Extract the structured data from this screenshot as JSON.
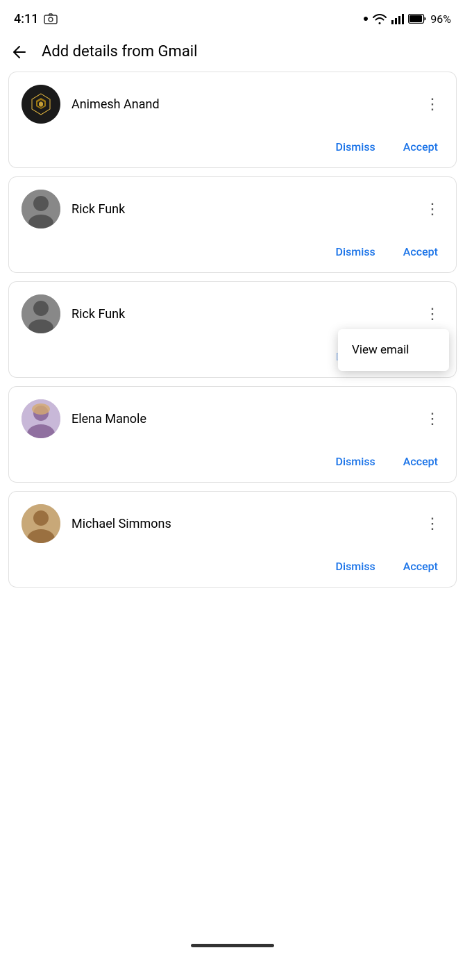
{
  "statusBar": {
    "time": "4:11",
    "battery": "96%"
  },
  "header": {
    "title": "Add details from Gmail",
    "backLabel": "←"
  },
  "contacts": [
    {
      "id": "animesh",
      "name": "Animesh Anand",
      "hasCustomAvatar": true,
      "dismissLabel": "Dismiss",
      "acceptLabel": "Accept",
      "showMenu": false
    },
    {
      "id": "rick1",
      "name": "Rick Funk",
      "hasCustomAvatar": false,
      "dismissLabel": "Dismiss",
      "acceptLabel": "Accept",
      "showMenu": false
    },
    {
      "id": "rick2",
      "name": "Rick Funk",
      "hasCustomAvatar": false,
      "dismissLabel": "Dismiss",
      "acceptLabel": "Accept",
      "showMenu": true
    },
    {
      "id": "elena",
      "name": "Elena Manole",
      "hasCustomAvatar": false,
      "dismissLabel": "Dismiss",
      "acceptLabel": "Accept",
      "showMenu": false
    },
    {
      "id": "michael",
      "name": "Michael Simmons",
      "hasCustomAvatar": false,
      "dismissLabel": "Dismiss",
      "acceptLabel": "Accept",
      "showMenu": false
    }
  ],
  "popupMenu": {
    "viewEmailLabel": "View email"
  }
}
